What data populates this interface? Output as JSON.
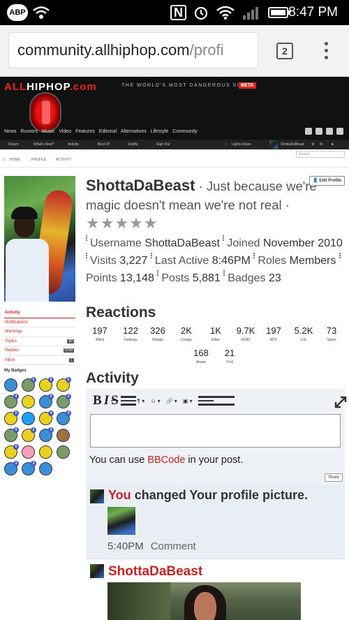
{
  "status_bar": {
    "adblock": "ABP",
    "time": "8:47 PM"
  },
  "browser": {
    "url_host": "community.allhiphop.com",
    "url_rest": "/profi",
    "tab_count": "2"
  },
  "site": {
    "logo_all": "ALL",
    "logo_hiphop": "HIPHOP",
    "logo_com": ".com",
    "tagline": "THE WORLD'S MOST DANGEROUS SITE",
    "beta": "BETA",
    "nav": [
      "News",
      "Rumors",
      "Music",
      "Video",
      "Features",
      "Editorial",
      "Alternatives",
      "Lifestyle",
      "Community"
    ],
    "subnav": {
      "forum": "Forum",
      "whats_new": "What's New?",
      "activity": "Activity",
      "best_of": "Best Of",
      "drafts": "Drafts",
      "sign_out": "Sign Out",
      "lights_down": "Lights Down",
      "user": "ShottaDaBeast"
    }
  },
  "breadcrumb": {
    "home": "HOME",
    "profile": "PROFILE",
    "activity": "ACTIVITY",
    "search_placeholder": "Search"
  },
  "sidebar": {
    "items": [
      {
        "label": "Activity",
        "count": ""
      },
      {
        "label": "Notifications",
        "count": ""
      },
      {
        "label": "Warnings",
        "count": ""
      },
      {
        "label": "Topics",
        "count": "82"
      },
      {
        "label": "Replies",
        "count": "5799"
      },
      {
        "label": "Inbox",
        "count": "1"
      }
    ],
    "badges_title": "My Badges",
    "badges": [
      {
        "color": "#3b8fd6",
        "num": ""
      },
      {
        "color": "#7a9b6a",
        "num": "5"
      },
      {
        "color": "#e8d21f",
        "num": "5"
      },
      {
        "color": "#e8d21f",
        "num": "5"
      },
      {
        "color": "#7a9b6a",
        "num": "4"
      },
      {
        "color": "#e8d21f",
        "num": ""
      },
      {
        "color": "#3b8fd6",
        "num": "3"
      },
      {
        "color": "#7a9b6a",
        "num": "3"
      },
      {
        "color": "#e8d21f",
        "num": "5"
      },
      {
        "color": "#1da1f2",
        "num": ""
      },
      {
        "color": "#e8d21f",
        "num": "4"
      },
      {
        "color": "#3b8fd6",
        "num": "3"
      },
      {
        "color": "#7a9b6a",
        "num": "5"
      },
      {
        "color": "#e8d21f",
        "num": "2"
      },
      {
        "color": "#3b8fd6",
        "num": "3"
      },
      {
        "color": "#a07040",
        "num": ""
      },
      {
        "color": "#e8d21f",
        "num": "5"
      },
      {
        "color": "#f3a1b8",
        "num": ""
      },
      {
        "color": "#e8d21f",
        "num": ""
      },
      {
        "color": "#7a9b6a",
        "num": ""
      },
      {
        "color": "#3b8fd6",
        "num": "3"
      },
      {
        "color": "#3b8fd6",
        "num": "3"
      },
      {
        "color": "#3b8fd6",
        "num": ""
      }
    ]
  },
  "profile": {
    "name": "ShottaDaBeast",
    "title_rest": "· Just because we're magic doesn't mean we're not real ·",
    "stars": "★★★★★",
    "edit_button": "Edit Profile",
    "username_label": "Username",
    "username": "ShottaDaBeast",
    "joined_label": "Joined",
    "joined": "November 2010",
    "visits_label": "Visits",
    "visits": "3,227",
    "last_active_label": "Last Active",
    "last_active": "8:46PM",
    "roles_label": "Roles",
    "roles": "Members",
    "points_label": "Points",
    "points": "13,148",
    "posts_label": "Posts",
    "posts": "5,881",
    "badges_label": "Badges",
    "badges": "23"
  },
  "reactions": {
    "title": "Reactions",
    "items": [
      {
        "n": "197",
        "label": "Wack"
      },
      {
        "n": "122",
        "label": "Feelings"
      },
      {
        "n": "326",
        "label": "Nosign"
      },
      {
        "n": "2K",
        "label": "Cosign"
      },
      {
        "n": "1K",
        "label": "Ether"
      },
      {
        "n": "9.7K",
        "label": "GOAT"
      },
      {
        "n": "197",
        "label": "WTF"
      },
      {
        "n": "5.2K",
        "label": "LOL"
      },
      {
        "n": "73",
        "label": "Spam"
      },
      {
        "n": "168",
        "label": "Abuse"
      },
      {
        "n": "21",
        "label": "Troll"
      }
    ]
  },
  "activity": {
    "title": "Activity",
    "hint_pre": "You can use",
    "hint_link": "BBCode",
    "hint_post": "in your post.",
    "share_button": "Share",
    "feed": [
      {
        "actor": "You",
        "text": "changed Your profile picture.",
        "time": "5:40PM",
        "comment": "Comment"
      },
      {
        "actor": "ShottaDaBeast"
      }
    ]
  }
}
